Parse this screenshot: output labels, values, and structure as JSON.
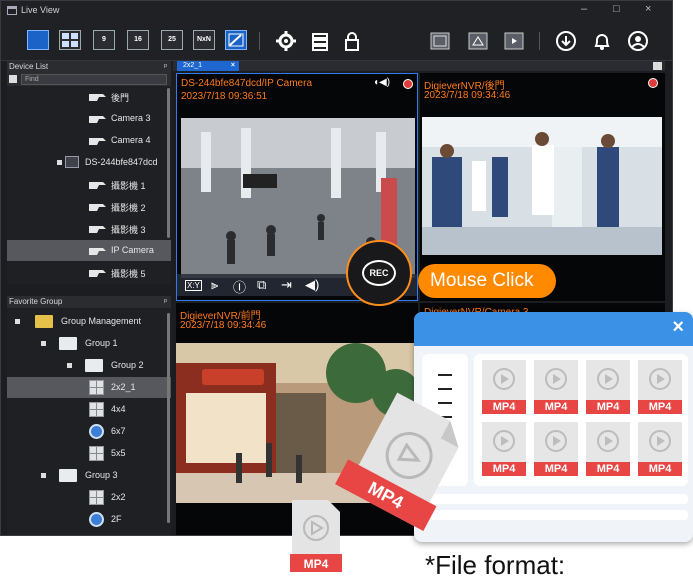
{
  "app": {
    "title": "Live View"
  },
  "window_controls": [
    "–",
    "□",
    "×"
  ],
  "toolbar": {
    "layouts": [
      "9",
      "16",
      "25",
      "NxN"
    ]
  },
  "device_list": {
    "header": "Device List",
    "search_placeholder": "Find",
    "items": [
      {
        "label": "後門",
        "type": "camera"
      },
      {
        "label": "Camera 3",
        "type": "camera"
      },
      {
        "label": "Camera 4",
        "type": "camera"
      },
      {
        "label": "DS-244bfe847dcd",
        "type": "nvr"
      },
      {
        "label": "攝影機 1",
        "type": "camera"
      },
      {
        "label": "攝影機 2",
        "type": "camera"
      },
      {
        "label": "攝影機 3",
        "type": "camera"
      },
      {
        "label": "IP Camera",
        "type": "camera",
        "selected": true
      },
      {
        "label": "攝影機 5",
        "type": "camera"
      }
    ]
  },
  "favorite_group": {
    "header": "Favorite Group",
    "items": [
      {
        "label": "Group Management"
      },
      {
        "label": "Group 1"
      },
      {
        "label": "Group 2"
      },
      {
        "label": "2x2_1",
        "selected": true
      },
      {
        "label": "4x4"
      },
      {
        "label": "6x7"
      },
      {
        "label": "5x5"
      },
      {
        "label": "Group 3"
      },
      {
        "label": "2x2"
      },
      {
        "label": "2F"
      }
    ]
  },
  "view_tab": {
    "label": "2x2_1",
    "close": "×"
  },
  "cells": [
    {
      "name": "DS-244bfe847dcd/IP Camera",
      "time": "2023/7/18 09:36:51"
    },
    {
      "name": "DigieverNVR/後門",
      "time": "2023/7/18 09:34:46"
    },
    {
      "name": "DigieverNVR/前門",
      "time": "2023/7/18 09:34:46"
    },
    {
      "name": "DigieverNVR/Camera 3",
      "time": ""
    }
  ],
  "controls": {
    "xy_label": "X:Y",
    "rec_label": "REC"
  },
  "callout": {
    "text": "Mouse Click"
  },
  "popup": {
    "close": "×",
    "file_label": "MP4",
    "file_count": 8
  },
  "big_files": [
    "MP4",
    "MP4"
  ],
  "caption": "*File format:",
  "colors": {
    "accent": "#1e66d0",
    "osd": "#ff7a1a",
    "rec": "#e23b3b",
    "callout": "#ff8a00",
    "popup_header": "#3a91e6",
    "mp4_tag": "#e84545"
  }
}
